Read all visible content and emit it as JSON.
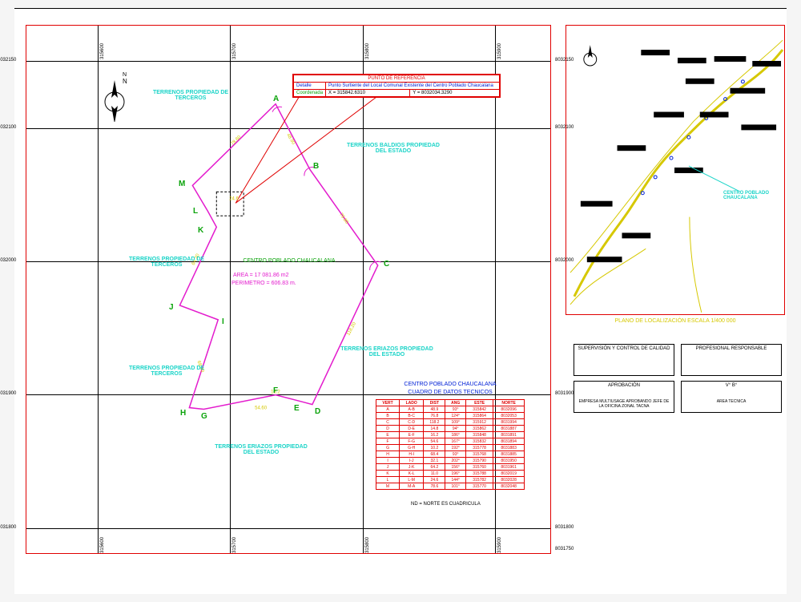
{
  "gridX": [
    "315600",
    "315700",
    "315800",
    "315900"
  ],
  "gridY_top": [
    "8032150"
  ],
  "gridY": [
    "8032100",
    "8032000",
    "8031900",
    "8031800",
    "8031750"
  ],
  "compass_label": "N",
  "labels": {
    "terr1": "TERRENOS PROPIEDAD DE TERCEROS",
    "terr2": "TERRENOS PROPIEDAD DE TERCEROS",
    "terr3": "TERRENOS PROPIEDAD DE TERCEROS",
    "terr4": "TERRENOS BALDIOS PROPIEDAD DEL ESTADO",
    "terr5": "TERRENOS ERIAZOS PROPIEDAD DEL ESTADO",
    "terr6": "TERRENOS ERIAZOS PROPIEDAD DEL ESTADO",
    "centro": "CENTRO POBLADO CHAUCALANA",
    "area": "AREA = 17 081.86 m2",
    "perimetro": "PERIMETRO = 606.83 m.",
    "footnote": "ND = NORTE ES CUADRICULA"
  },
  "info": {
    "header": "PUNTO DE REFERENCIA",
    "row1_k": "Detalle",
    "row1_v": "Punto Surtiente del Local Comunal Existente del Centro Poblado Chaucalana",
    "row2_k": "Coordenada",
    "row2_x": "X = 315842.6310",
    "row2_y": "Y = 8032034.3290"
  },
  "table": {
    "title": "CENTRO POBLADO CHAUCALANA",
    "subtitle": "CUADRO DE DATOS TECNICOS",
    "headers": [
      "VERT",
      "LADO",
      "DIST",
      "ANG",
      "ESTE",
      "NORTE"
    ],
    "rows": [
      [
        "A",
        "A-B",
        "48.9",
        "93°",
        "315842",
        "8032096"
      ],
      [
        "B",
        "B-C",
        "76.8",
        "124°",
        "315864",
        "8032053"
      ],
      [
        "C",
        "C-D",
        "118.2",
        "109°",
        "315912",
        "8031994"
      ],
      [
        "D",
        "D-E",
        "14.8",
        "94°",
        "315862",
        "8031887"
      ],
      [
        "E",
        "E-F",
        "16.2",
        "186°",
        "315848",
        "8031891"
      ],
      [
        "F",
        "F-G",
        "54.6",
        "167°",
        "315832",
        "8031894"
      ],
      [
        "G",
        "G-H",
        "10.2",
        "192°",
        "315778",
        "8031883"
      ],
      [
        "H",
        "H-I",
        "68.4",
        "93°",
        "315768",
        "8031885"
      ],
      [
        "I",
        "I-J",
        "32.1",
        "202°",
        "315790",
        "8031950"
      ],
      [
        "J",
        "J-K",
        "64.2",
        "156°",
        "315760",
        "8031961"
      ],
      [
        "K",
        "K-L",
        "11.0",
        "196°",
        "315788",
        "8032019"
      ],
      [
        "L",
        "L-M",
        "24.6",
        "144°",
        "315782",
        "8032028"
      ],
      [
        "M",
        "M-A",
        "78.6",
        "101°",
        "315770",
        "8032048"
      ]
    ]
  },
  "vertices": [
    "A",
    "B",
    "C",
    "D",
    "E",
    "F",
    "G",
    "H",
    "I",
    "J",
    "K",
    "L",
    "M"
  ],
  "loc_title": "PLANO DE LOCALIZACIÓN ESCALA 1/400 000",
  "loc_callout": "CENTRO POBLADO CHAUCALANA",
  "titleblock": {
    "supervision": "SUPERVISIÓN Y CONTROL DE CALIDAD",
    "profesional": "PROFESIONAL RESPONSABLE",
    "aprobacion": "APROBACIÓN",
    "vb": "V° B°",
    "jefe": "EMPRESA MULTIUSAGE APROBANDO JEFE DE LA OFICINA ZONAL TACNA",
    "area": "AREA TECNICA"
  }
}
